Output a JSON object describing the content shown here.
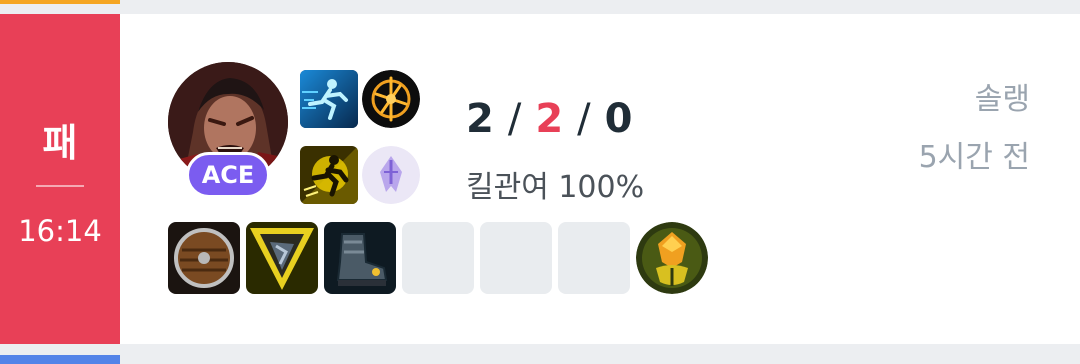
{
  "match": {
    "result_label": "패",
    "duration": "16:14",
    "result_color": "#e84057"
  },
  "champion": {
    "icon": "champion-portrait-icon",
    "badge_label": "ACE",
    "badge_color": "#7b5cf0"
  },
  "spells": [
    {
      "icon": "ghost-spell-icon"
    },
    {
      "icon": "ignite-spell-icon"
    }
  ],
  "runes": [
    {
      "icon": "phase-rush-rune-icon"
    },
    {
      "icon": "sorcery-tree-rune-icon"
    }
  ],
  "stats": {
    "kills": "2",
    "deaths": "2",
    "assists": "0",
    "kill_participation": "킬관여 100%"
  },
  "meta": {
    "queue": "솔랭",
    "time_ago": "5시간 전"
  },
  "items": [
    {
      "icon": "wooden-shield-item-icon",
      "empty": false
    },
    {
      "icon": "gold-cape-item-icon",
      "empty": false
    },
    {
      "icon": "armored-boots-item-icon",
      "empty": false
    },
    {
      "icon": "empty-item-slot",
      "empty": true
    },
    {
      "icon": "empty-item-slot",
      "empty": true
    },
    {
      "icon": "empty-item-slot",
      "empty": true
    }
  ],
  "trinket": {
    "icon": "ward-trinket-icon"
  }
}
